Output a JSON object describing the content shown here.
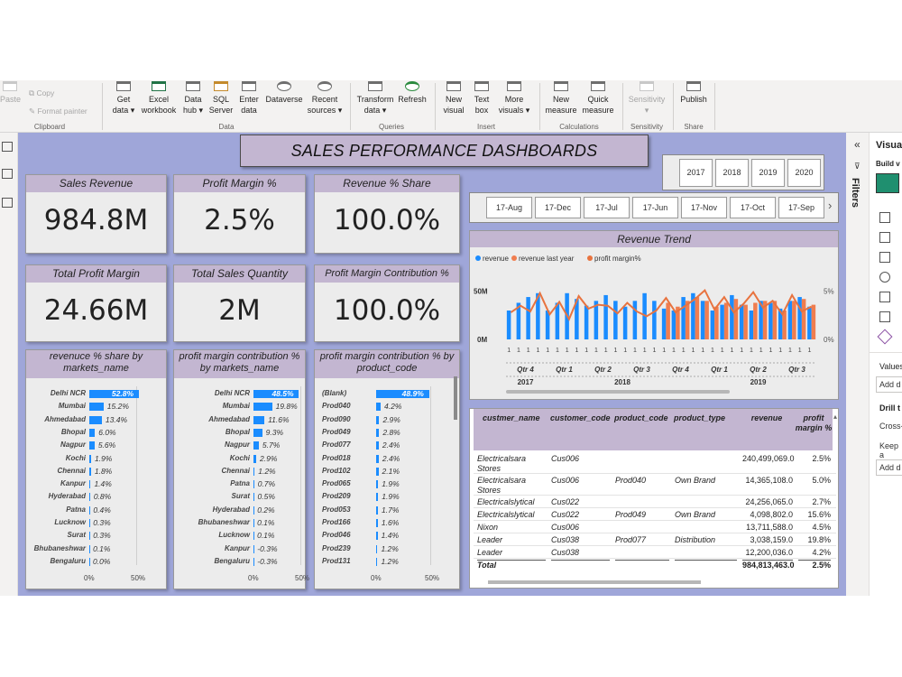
{
  "ribbon": {
    "clipboard": {
      "paste": "Paste",
      "copy": "Copy",
      "format_painter": "Format painter",
      "group": "Clipboard"
    },
    "data": {
      "get_data": "Get data ▾",
      "excel": "Excel workbook",
      "data_hub": "Data hub ▾",
      "sql": "SQL Server",
      "enter": "Enter data",
      "dataverse": "Dataverse",
      "recent": "Recent sources ▾",
      "group": "Data"
    },
    "queries": {
      "transform": "Transform data ▾",
      "refresh": "Refresh",
      "group": "Queries"
    },
    "insert": {
      "new_visual": "New visual",
      "text_box": "Text box",
      "more_visuals": "More visuals ▾",
      "group": "Insert"
    },
    "calculations": {
      "new_measure": "New measure",
      "quick_measure": "Quick measure",
      "group": "Calculations"
    },
    "sensitivity": {
      "label": "Sensitivity ▾",
      "group": "Sensitivity"
    },
    "share": {
      "publish": "Publish",
      "group": "Share"
    }
  },
  "dashboard": {
    "title": "SALES PERFORMANCE DASHBOARDS",
    "kpis": [
      {
        "label": "Sales Revenue",
        "value": "984.8M"
      },
      {
        "label": "Profit Margin %",
        "value": "2.5%"
      },
      {
        "label": "Revenue % Share",
        "value": "100.0%"
      },
      {
        "label": "Total Profit Margin",
        "value": "24.66M"
      },
      {
        "label": "Total Sales Quantity",
        "value": "2M"
      },
      {
        "label": "Profit Margin Contribution %",
        "value": "100.0%"
      }
    ],
    "year_slicer": [
      "2017",
      "2018",
      "2019",
      "2020"
    ],
    "date_slicer": [
      "17-Aug",
      "17-Dec",
      "17-Jul",
      "17-Jun",
      "17-Nov",
      "17-Oct",
      "17-Sep"
    ],
    "bar_panels": [
      {
        "title": "revenuce % share by markets_name",
        "axis": [
          "0%",
          "50%"
        ],
        "rows": [
          {
            "label": "Delhi NCR",
            "value": 52.8,
            "text": "52.8%"
          },
          {
            "label": "Mumbai",
            "value": 15.2,
            "text": "15.2%"
          },
          {
            "label": "Ahmedabad",
            "value": 13.4,
            "text": "13.4%"
          },
          {
            "label": "Bhopal",
            "value": 6.0,
            "text": "6.0%"
          },
          {
            "label": "Nagpur",
            "value": 5.6,
            "text": "5.6%"
          },
          {
            "label": "Kochi",
            "value": 1.9,
            "text": "1.9%"
          },
          {
            "label": "Chennai",
            "value": 1.8,
            "text": "1.8%"
          },
          {
            "label": "Kanpur",
            "value": 1.4,
            "text": "1.4%"
          },
          {
            "label": "Hyderabad",
            "value": 0.8,
            "text": "0.8%"
          },
          {
            "label": "Patna",
            "value": 0.4,
            "text": "0.4%"
          },
          {
            "label": "Lucknow",
            "value": 0.3,
            "text": "0.3%"
          },
          {
            "label": "Surat",
            "value": 0.3,
            "text": "0.3%"
          },
          {
            "label": "Bhubaneshwar",
            "value": 0.1,
            "text": "0.1%"
          },
          {
            "label": "Bengaluru",
            "value": 0.0,
            "text": "0.0%"
          }
        ]
      },
      {
        "title": "profit margin contribution % by markets_name",
        "axis": [
          "0%",
          "50%"
        ],
        "rows": [
          {
            "label": "Delhi NCR",
            "value": 48.5,
            "text": "48.5%"
          },
          {
            "label": "Mumbai",
            "value": 19.8,
            "text": "19.8%"
          },
          {
            "label": "Ahmedabad",
            "value": 11.6,
            "text": "11.6%"
          },
          {
            "label": "Bhopal",
            "value": 9.3,
            "text": "9.3%"
          },
          {
            "label": "Nagpur",
            "value": 5.7,
            "text": "5.7%"
          },
          {
            "label": "Kochi",
            "value": 2.9,
            "text": "2.9%"
          },
          {
            "label": "Chennai",
            "value": 1.2,
            "text": "1.2%"
          },
          {
            "label": "Patna",
            "value": 0.7,
            "text": "0.7%"
          },
          {
            "label": "Surat",
            "value": 0.5,
            "text": "0.5%"
          },
          {
            "label": "Hyderabad",
            "value": 0.2,
            "text": "0.2%"
          },
          {
            "label": "Bhubaneshwar",
            "value": 0.1,
            "text": "0.1%"
          },
          {
            "label": "Lucknow",
            "value": 0.1,
            "text": "0.1%"
          },
          {
            "label": "Kanpur",
            "value": -0.3,
            "text": "-0.3%"
          },
          {
            "label": "Bengaluru",
            "value": -0.3,
            "text": "-0.3%"
          }
        ]
      },
      {
        "title": "profit margin contribution % by product_code",
        "axis": [
          "0%",
          "50%"
        ],
        "rows": [
          {
            "label": "(Blank)",
            "value": 48.9,
            "text": "48.9%"
          },
          {
            "label": "Prod040",
            "value": 4.2,
            "text": "4.2%"
          },
          {
            "label": "Prod090",
            "value": 2.9,
            "text": "2.9%"
          },
          {
            "label": "Prod049",
            "value": 2.8,
            "text": "2.8%"
          },
          {
            "label": "Prod077",
            "value": 2.4,
            "text": "2.4%"
          },
          {
            "label": "Prod018",
            "value": 2.4,
            "text": "2.4%"
          },
          {
            "label": "Prod102",
            "value": 2.1,
            "text": "2.1%"
          },
          {
            "label": "Prod065",
            "value": 1.9,
            "text": "1.9%"
          },
          {
            "label": "Prod209",
            "value": 1.9,
            "text": "1.9%"
          },
          {
            "label": "Prod053",
            "value": 1.7,
            "text": "1.7%"
          },
          {
            "label": "Prod166",
            "value": 1.6,
            "text": "1.6%"
          },
          {
            "label": "Prod046",
            "value": 1.4,
            "text": "1.4%"
          },
          {
            "label": "Prod239",
            "value": 1.2,
            "text": "1.2%"
          },
          {
            "label": "Prod131",
            "value": 1.2,
            "text": "1.2%"
          }
        ]
      }
    ],
    "table": {
      "headers": [
        "custmer_name",
        "customer_code",
        "product_code",
        "product_type",
        "revenue",
        "profit margin %"
      ],
      "rows": [
        [
          "Electricalsara Stores",
          "Cus006",
          "",
          "",
          "240,499,069.0",
          "2.5%"
        ],
        [
          "Electricalsara Stores",
          "Cus006",
          "Prod040",
          "Own Brand",
          "14,365,108.0",
          "5.0%"
        ],
        [
          "Electricalslytical",
          "Cus022",
          "",
          "",
          "24,256,065.0",
          "2.7%"
        ],
        [
          "Electricalslytical",
          "Cus022",
          "Prod049",
          "Own Brand",
          "4,098,802.0",
          "15.6%"
        ],
        [
          "Nixon",
          "Cus006",
          "",
          "",
          "13,711,588.0",
          "4.5%"
        ],
        [
          "Leader",
          "Cus038",
          "Prod077",
          "Distribution",
          "3,038,159.0",
          "19.8%"
        ],
        [
          "Leader",
          "Cus038",
          "",
          "",
          "12,200,036.0",
          "4.2%"
        ]
      ],
      "total": [
        "Total",
        "",
        "",
        "",
        "984,813,463.0",
        "2.5%"
      ]
    }
  },
  "right_panel": {
    "filters": "Filters",
    "visualizations": "Visua",
    "build": "Build v",
    "values": "Values",
    "add": "Add d",
    "drill": "Drill t",
    "cross": "Cross-",
    "keep": "Keep a",
    "add2": "Add d"
  },
  "chart_data": {
    "type": "line",
    "title": "Revenue Trend",
    "legend": [
      "revenue",
      "revenue last year",
      "profit margin%"
    ],
    "legend_position": "top-left",
    "colors": {
      "revenue": "#1a8cff",
      "revenue last year": "#f07d4f",
      "profit margin%": "#e8733f"
    },
    "y_left": {
      "ticks": [
        "50M",
        "0M"
      ],
      "range": [
        0,
        60
      ]
    },
    "y_right": {
      "ticks": [
        "5%",
        "0%"
      ],
      "range": [
        0,
        6
      ]
    },
    "x_groups_quarter": [
      "Qtr 4",
      "Qtr 1",
      "Qtr 2",
      "Qtr 3",
      "Qtr 4",
      "Qtr 1",
      "Qtr 2",
      "Qtr 3"
    ],
    "x_groups_year": [
      "2017",
      "2018",
      "2019"
    ],
    "series": [
      {
        "name": "revenue",
        "values": [
          30,
          38,
          44,
          48,
          30,
          38,
          48,
          42,
          35,
          40,
          46,
          40,
          34,
          40,
          48,
          40,
          32,
          30,
          44,
          48,
          40,
          30,
          36,
          46,
          36,
          30,
          40,
          38,
          32,
          40,
          44,
          34
        ]
      },
      {
        "name": "revenue last year",
        "values": [
          0,
          0,
          0,
          0,
          0,
          0,
          0,
          0,
          0,
          0,
          0,
          0,
          0,
          0,
          0,
          0,
          38,
          34,
          40,
          44,
          40,
          34,
          38,
          42,
          36,
          38,
          40,
          40,
          30,
          40,
          42,
          36
        ]
      },
      {
        "name": "profit margin%",
        "values": [
          2.8,
          3.5,
          2.9,
          4.8,
          2.6,
          3.9,
          2.1,
          4.5,
          3.2,
          3.6,
          3.5,
          2.7,
          3.8,
          2.9,
          2.4,
          3.0,
          4.3,
          2.8,
          3.5,
          4.2,
          5.1,
          3.1,
          4.4,
          2.8,
          3.7,
          4.9,
          3.3,
          4.0,
          2.6,
          4.6,
          2.9,
          3.4
        ]
      }
    ]
  }
}
